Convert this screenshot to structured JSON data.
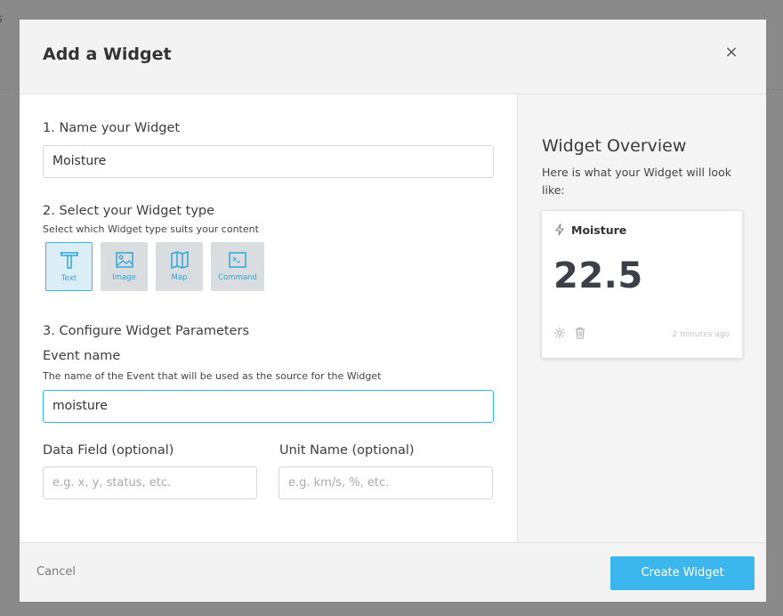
{
  "backdrop": {
    "fragment": "s"
  },
  "modal": {
    "title": "Add a Widget",
    "close_symbol": "×"
  },
  "step1": {
    "label": "1. Name your Widget",
    "value": "Moisture"
  },
  "step2": {
    "label": "2. Select your Widget type",
    "help": "Select which Widget type suits your content",
    "types": [
      {
        "label": "Text",
        "icon": "text-type-icon",
        "selected": true
      },
      {
        "label": "Image",
        "icon": "image-icon",
        "selected": false
      },
      {
        "label": "Map",
        "icon": "map-icon",
        "selected": false
      },
      {
        "label": "Command",
        "icon": "terminal-icon",
        "selected": false
      }
    ]
  },
  "step3": {
    "label": "3. Configure Widget Parameters",
    "event_name": {
      "label": "Event name",
      "help": "The name of the Event that will be used as the source for the Widget",
      "value": "moisture"
    },
    "data_field": {
      "label": "Data Field (optional)",
      "placeholder": "e.g. x, y, status, etc."
    },
    "unit_name": {
      "label": "Unit Name (optional)",
      "placeholder": "e.g. km/s, %, etc."
    }
  },
  "overview": {
    "title": "Widget Overview",
    "description": "Here is what your Widget will look like:",
    "card": {
      "name": "Moisture",
      "value": "22.5",
      "timestamp": "2 minutes ago",
      "icon": "lightning-icon"
    }
  },
  "footer": {
    "cancel_label": "Cancel",
    "create_label": "Create Widget"
  },
  "colors": {
    "accent": "#3bb7ee",
    "value_text": "#3b3f48"
  }
}
